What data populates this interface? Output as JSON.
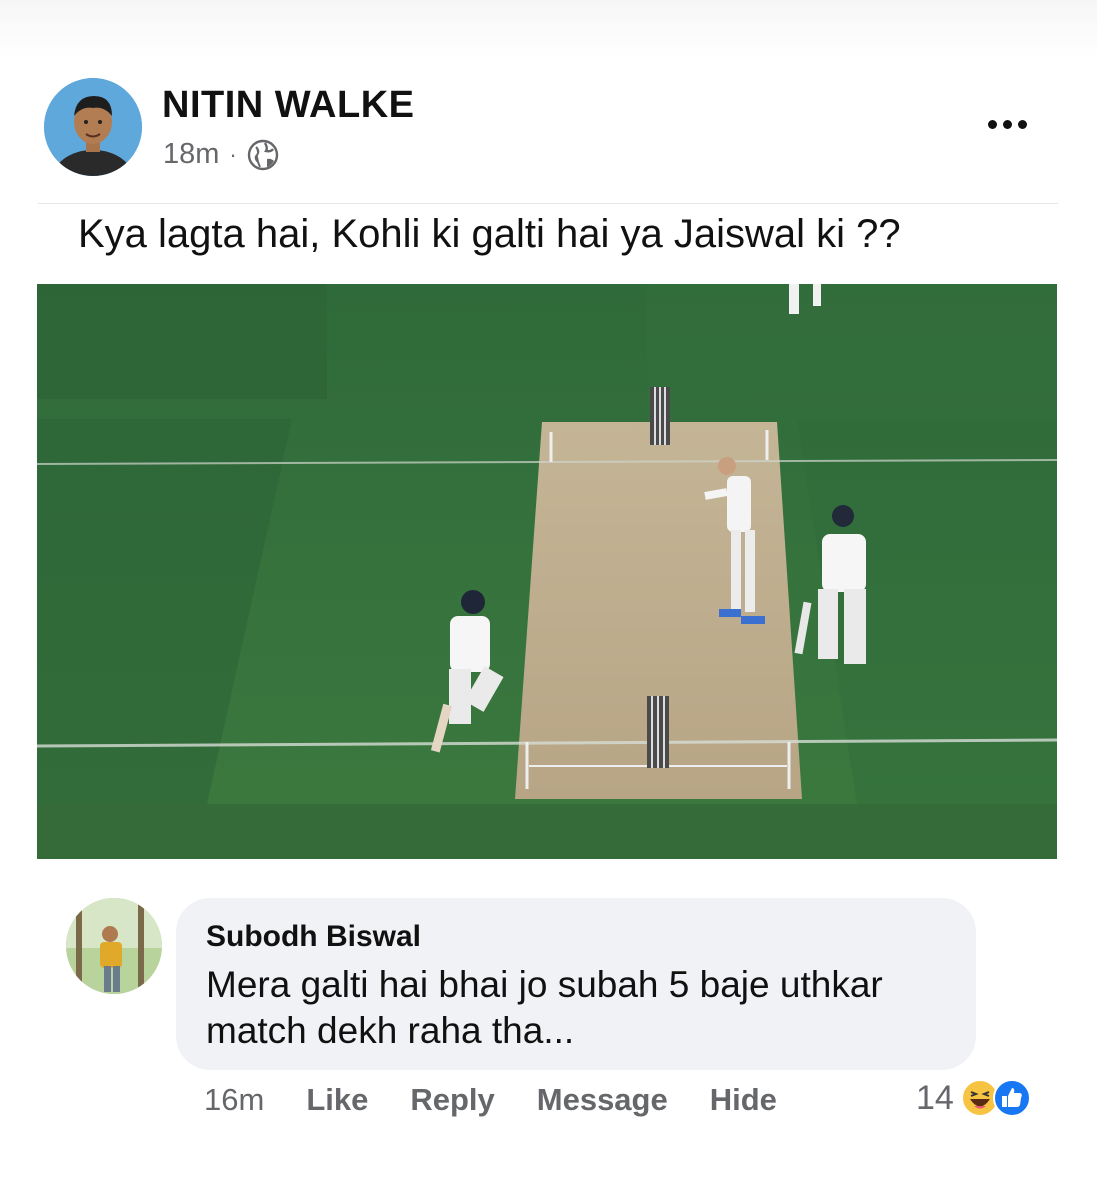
{
  "post": {
    "author": "NITIN WALKE",
    "time": "18m",
    "separator": "·",
    "privacy_icon": "globe-icon",
    "more_icon": "more-options-icon",
    "text": "Kya lagta hai, Kohli ki galti hai ya Jaiswal ki ??",
    "image_description_icon": "cricket-photo"
  },
  "comment": {
    "author": "Subodh Biswal",
    "text": "Mera galti hai bhai jo subah 5 baje uthkar match dekh raha tha...",
    "time": "16m",
    "actions": {
      "like": "Like",
      "reply": "Reply",
      "message": "Message",
      "hide": "Hide"
    },
    "reaction_count": "14",
    "reaction_icons": [
      "haha-icon",
      "like-icon"
    ]
  },
  "colors": {
    "secondary_text": "#65676b",
    "bubble_bg": "#f0f2f5",
    "like_blue": "#1877f2",
    "haha_yellow": "#f7c342"
  }
}
